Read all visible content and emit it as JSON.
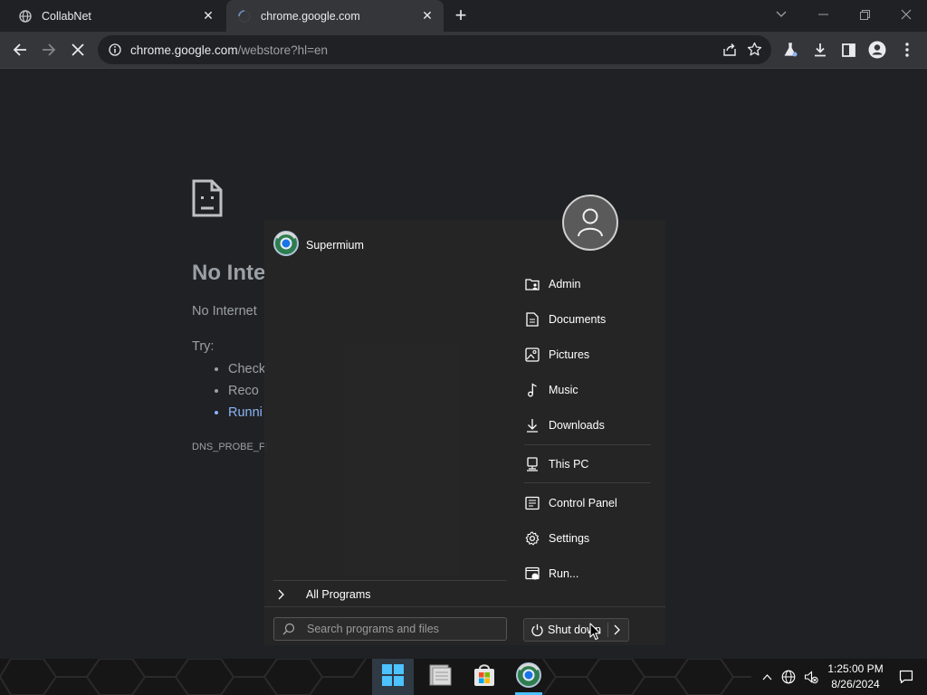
{
  "tabs": [
    {
      "title": "CollabNet",
      "icon": "globe-icon"
    },
    {
      "title": "chrome.google.com",
      "icon": "loading-spinner-icon"
    }
  ],
  "toolbar": {
    "url_host": "chrome.google.com",
    "url_path": "/webstore?hl=en"
  },
  "error_page": {
    "title": "No Inte",
    "subtitle": "No Internet",
    "try_label": "Try:",
    "suggestions": [
      "Check",
      "Reco",
      "Runni"
    ],
    "code": "DNS_PROBE_FI"
  },
  "start_menu": {
    "pinned_app": "Supermium",
    "all_programs": "All Programs",
    "search_placeholder": "Search programs and files",
    "shutdown_label": "Shut down",
    "right_items": [
      {
        "label": "Admin",
        "icon": "user-folder-icon"
      },
      {
        "label": "Documents",
        "icon": "document-icon"
      },
      {
        "label": "Pictures",
        "icon": "picture-icon"
      },
      {
        "label": "Music",
        "icon": "music-note-icon"
      },
      {
        "label": "Downloads",
        "icon": "download-icon"
      },
      {
        "label": "This PC",
        "icon": "computer-icon"
      },
      {
        "label": "Control Panel",
        "icon": "control-panel-icon"
      },
      {
        "label": "Settings",
        "icon": "gear-icon"
      },
      {
        "label": "Run...",
        "icon": "run-icon"
      }
    ]
  },
  "taskbar": {
    "time": "1:25:00 PM",
    "date": "8/26/2024"
  },
  "colors": {
    "accent": "#4cc2ff",
    "link": "#8ab4f8",
    "page_bg": "#202124",
    "toolbar_bg": "#35363a"
  }
}
